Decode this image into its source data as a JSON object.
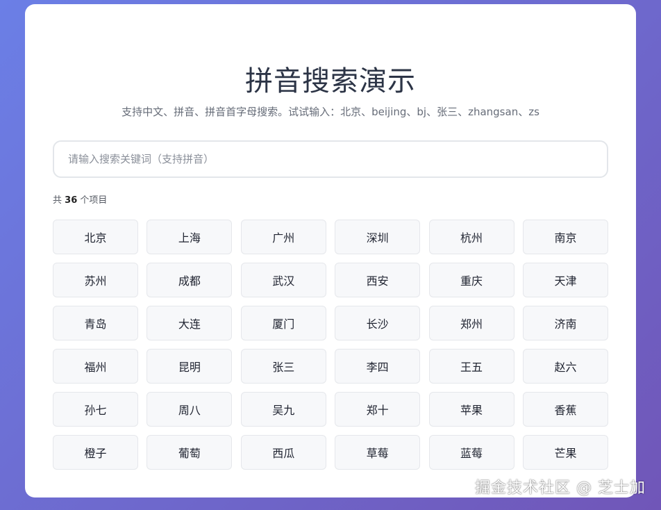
{
  "header": {
    "title": "拼音搜索演示",
    "subtitle": "支持中文、拼音、拼音首字母搜索。试试输入：北京、beijing、bj、张三、zhangsan、zs"
  },
  "search": {
    "placeholder": "请输入搜索关键词（支持拼音）",
    "value": ""
  },
  "results": {
    "count_prefix": "共",
    "count": "36",
    "count_suffix": "个项目",
    "items": [
      "北京",
      "上海",
      "广州",
      "深圳",
      "杭州",
      "南京",
      "苏州",
      "成都",
      "武汉",
      "西安",
      "重庆",
      "天津",
      "青岛",
      "大连",
      "厦门",
      "长沙",
      "郑州",
      "济南",
      "福州",
      "昆明",
      "张三",
      "李四",
      "王五",
      "赵六",
      "孙七",
      "周八",
      "吴九",
      "郑十",
      "苹果",
      "香蕉",
      "橙子",
      "葡萄",
      "西瓜",
      "草莓",
      "蓝莓",
      "芒果"
    ]
  },
  "watermark": "掘金技术社区 @ 芝士加",
  "colors": {
    "background_start": "#6b7fe6",
    "background_end": "#7056b8",
    "card": "#ffffff",
    "item_bg": "#f7f8fa",
    "item_border": "#e5e7eb"
  }
}
